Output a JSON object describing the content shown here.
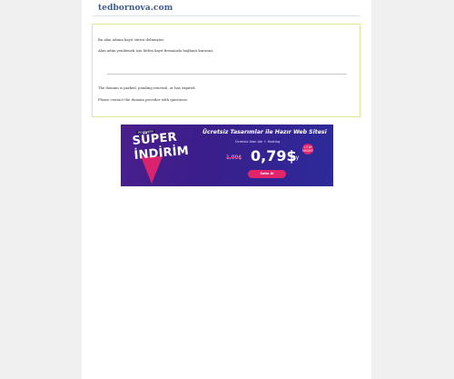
{
  "site": {
    "title": "tedbornova.com"
  },
  "notice": {
    "line1": "Bu alan adının kayıt süresi dolmuştur.",
    "line2": "Alan adını yenilemek için lütfen kayıt firmanızla bağlantı kurunuz.",
    "line3": "The domain is parked, pending renewal, or has expired.",
    "line4": "Please contact the domain provider with questions."
  },
  "ad": {
    "tag": "Hostinglim",
    "super": "SÜPER",
    "indirim": "İNDİRİM",
    "headline": "Ücretsiz Tasarımlar ile Hazır Web Sitesi",
    "sub": "Ücretsiz Alan Adı + Hosting",
    "old_price": "1,99$",
    "new_price": "0,79$",
    "unit": "/ay",
    "badge": "+3 AY HEDİYE",
    "cta": "Satın Al",
    "colors": {
      "background": "#3a1e8a",
      "accent": "#e2246b"
    }
  }
}
